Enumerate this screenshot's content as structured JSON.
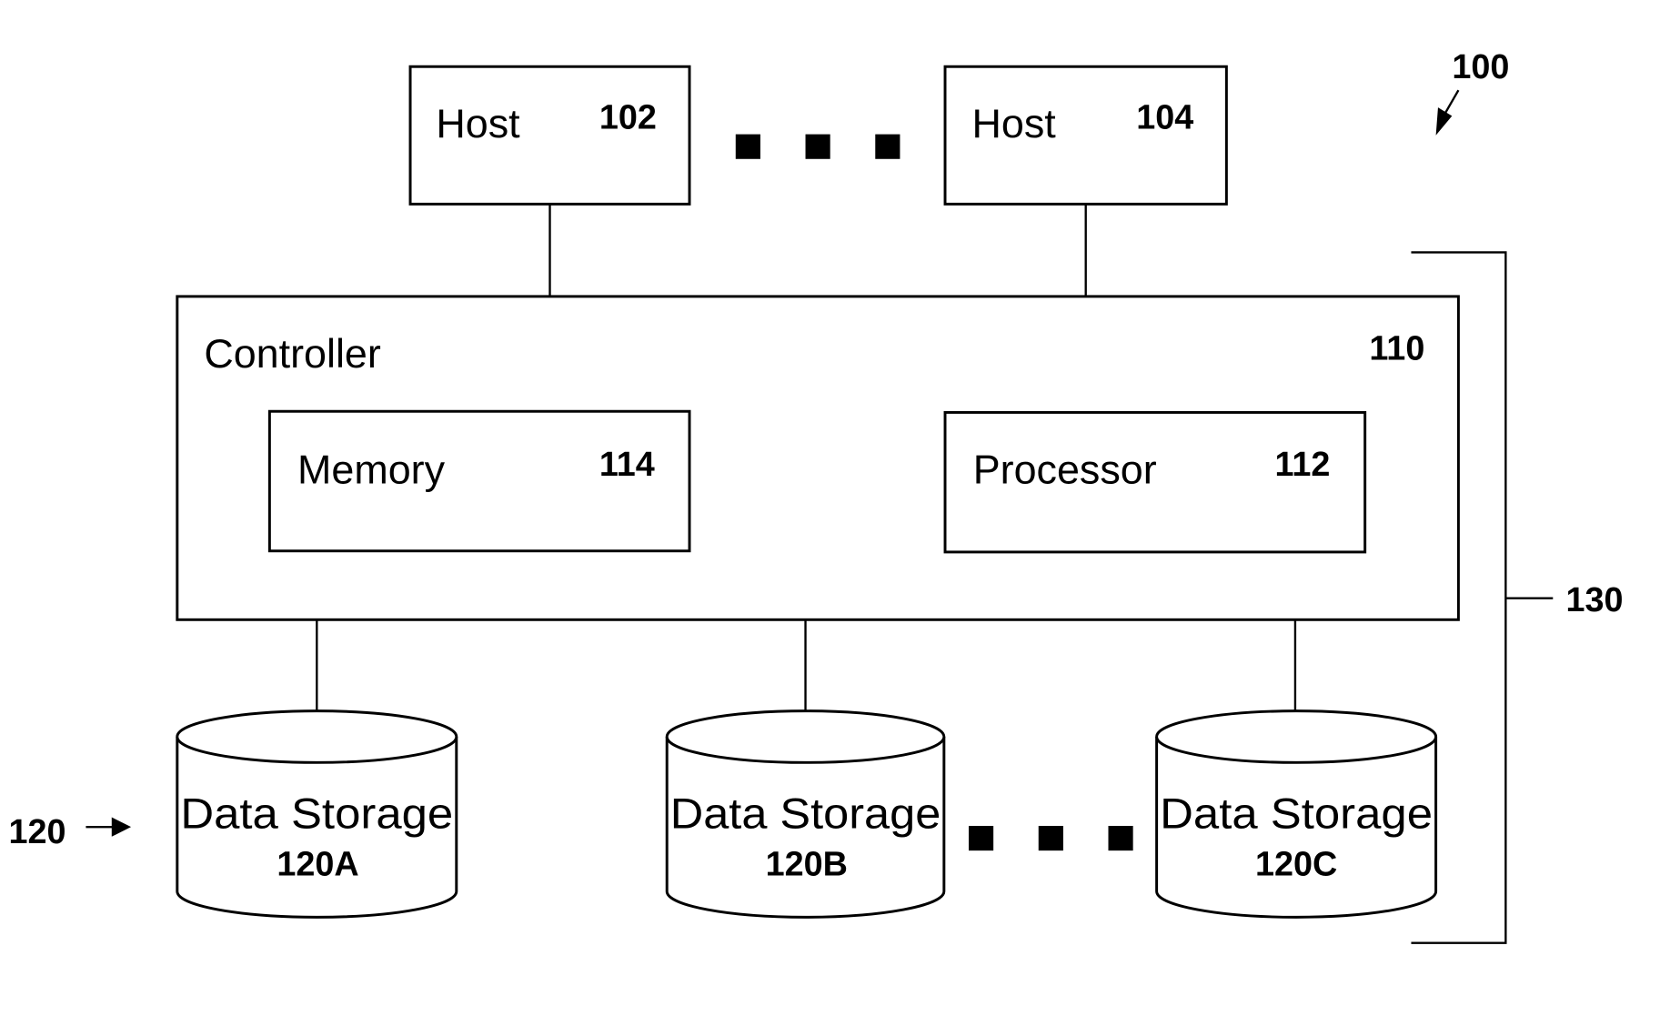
{
  "figure": {
    "ref": "100",
    "hosts": [
      {
        "label": "Host",
        "ref": "102"
      },
      {
        "label": "Host",
        "ref": "104"
      }
    ],
    "controller": {
      "label": "Controller",
      "ref": "110",
      "memory": {
        "label": "Memory",
        "ref": "114"
      },
      "processor": {
        "label": "Processor",
        "ref": "112"
      }
    },
    "storage_group_ref": "120",
    "system_bracket_ref": "130",
    "storages": [
      {
        "label": "Data Storage",
        "ref": "120A"
      },
      {
        "label": "Data Storage",
        "ref": "120B"
      },
      {
        "label": "Data Storage",
        "ref": "120C"
      }
    ]
  }
}
